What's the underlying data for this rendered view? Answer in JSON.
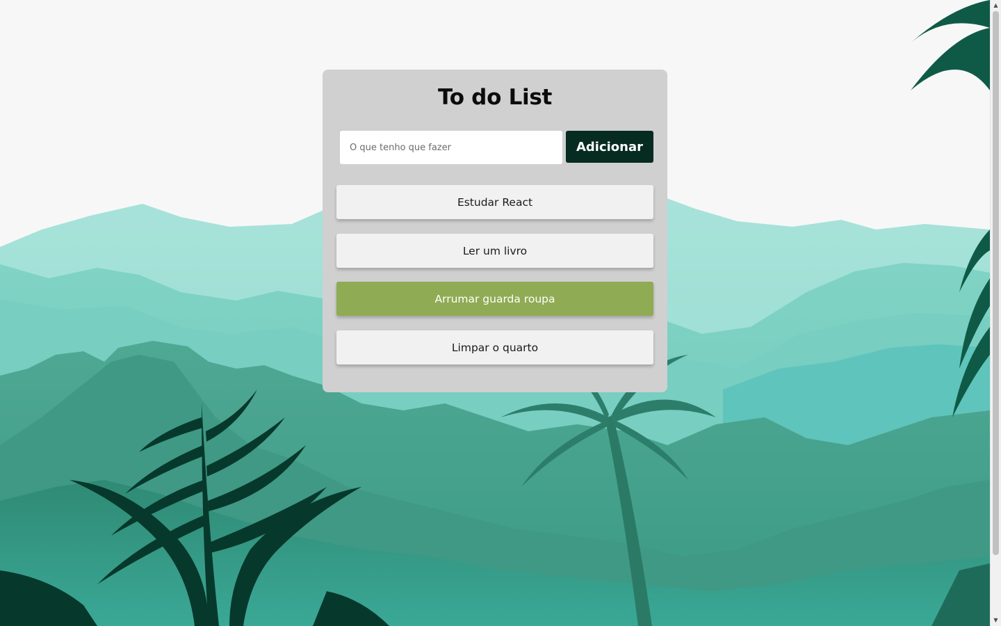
{
  "app": {
    "title": "To do List"
  },
  "form": {
    "placeholder": "O que tenho que fazer",
    "value": "",
    "add_label": "Adicionar"
  },
  "tasks": [
    {
      "label": "Estudar React",
      "done": false
    },
    {
      "label": "Ler um livro",
      "done": false
    },
    {
      "label": "Arrumar guarda roupa",
      "done": true
    },
    {
      "label": "Limpar o quarto",
      "done": false
    }
  ],
  "colors": {
    "card_bg": "#d0d0d0",
    "button_bg": "#062b20",
    "task_bg": "#f1f1f1",
    "task_done_bg": "#8fab54",
    "page_bg": "#f7f7f7"
  }
}
